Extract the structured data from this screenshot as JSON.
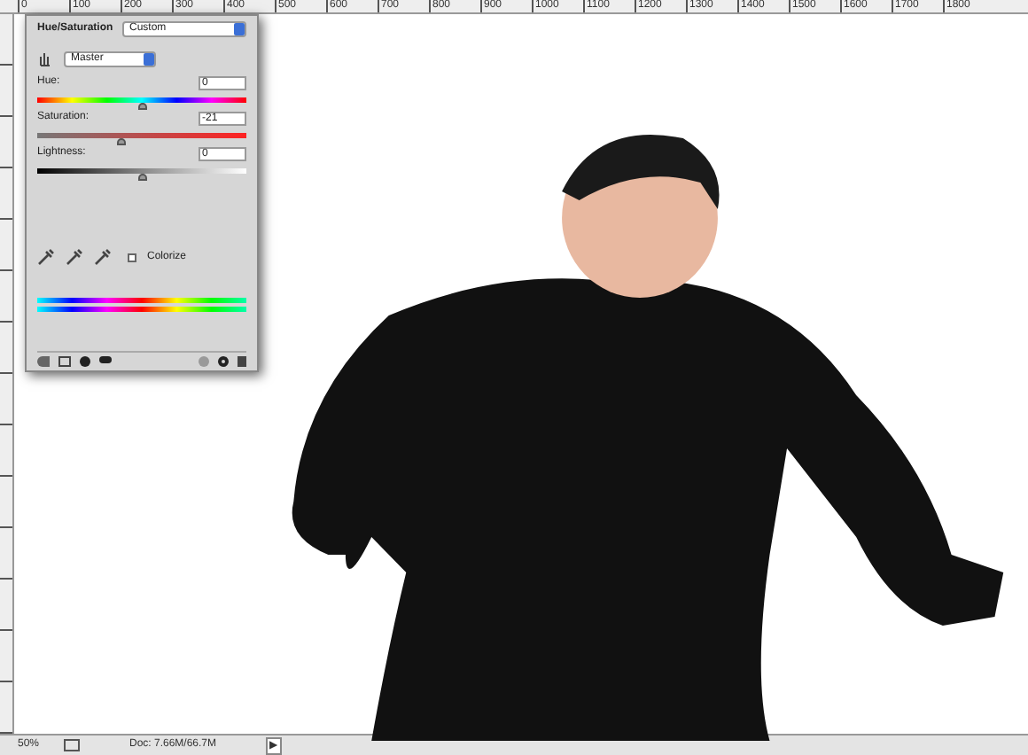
{
  "ruler": {
    "labels": [
      "0",
      "100",
      "200",
      "300",
      "400",
      "500",
      "600",
      "700",
      "800",
      "900",
      "1000",
      "1100",
      "1200",
      "1300",
      "1400",
      "1500",
      "1600",
      "1700",
      "1800"
    ]
  },
  "panel": {
    "title": "Hue/Saturation",
    "preset": "Custom",
    "channel": "Master",
    "sliders": [
      {
        "label": "Hue:",
        "value": "0",
        "level": 0.5,
        "kind": "spectrum"
      },
      {
        "label": "Saturation:",
        "value": "-21",
        "level": 0.4,
        "kind": "saturation"
      },
      {
        "label": "Lightness:",
        "value": "0",
        "level": 0.5,
        "kind": "lightness"
      }
    ],
    "colorize": {
      "label": "Colorize",
      "checked": false
    }
  },
  "status_bar": {
    "zoom": "50%",
    "doc": "Doc: 7.66M/66.7M",
    "arrow": "▶"
  }
}
